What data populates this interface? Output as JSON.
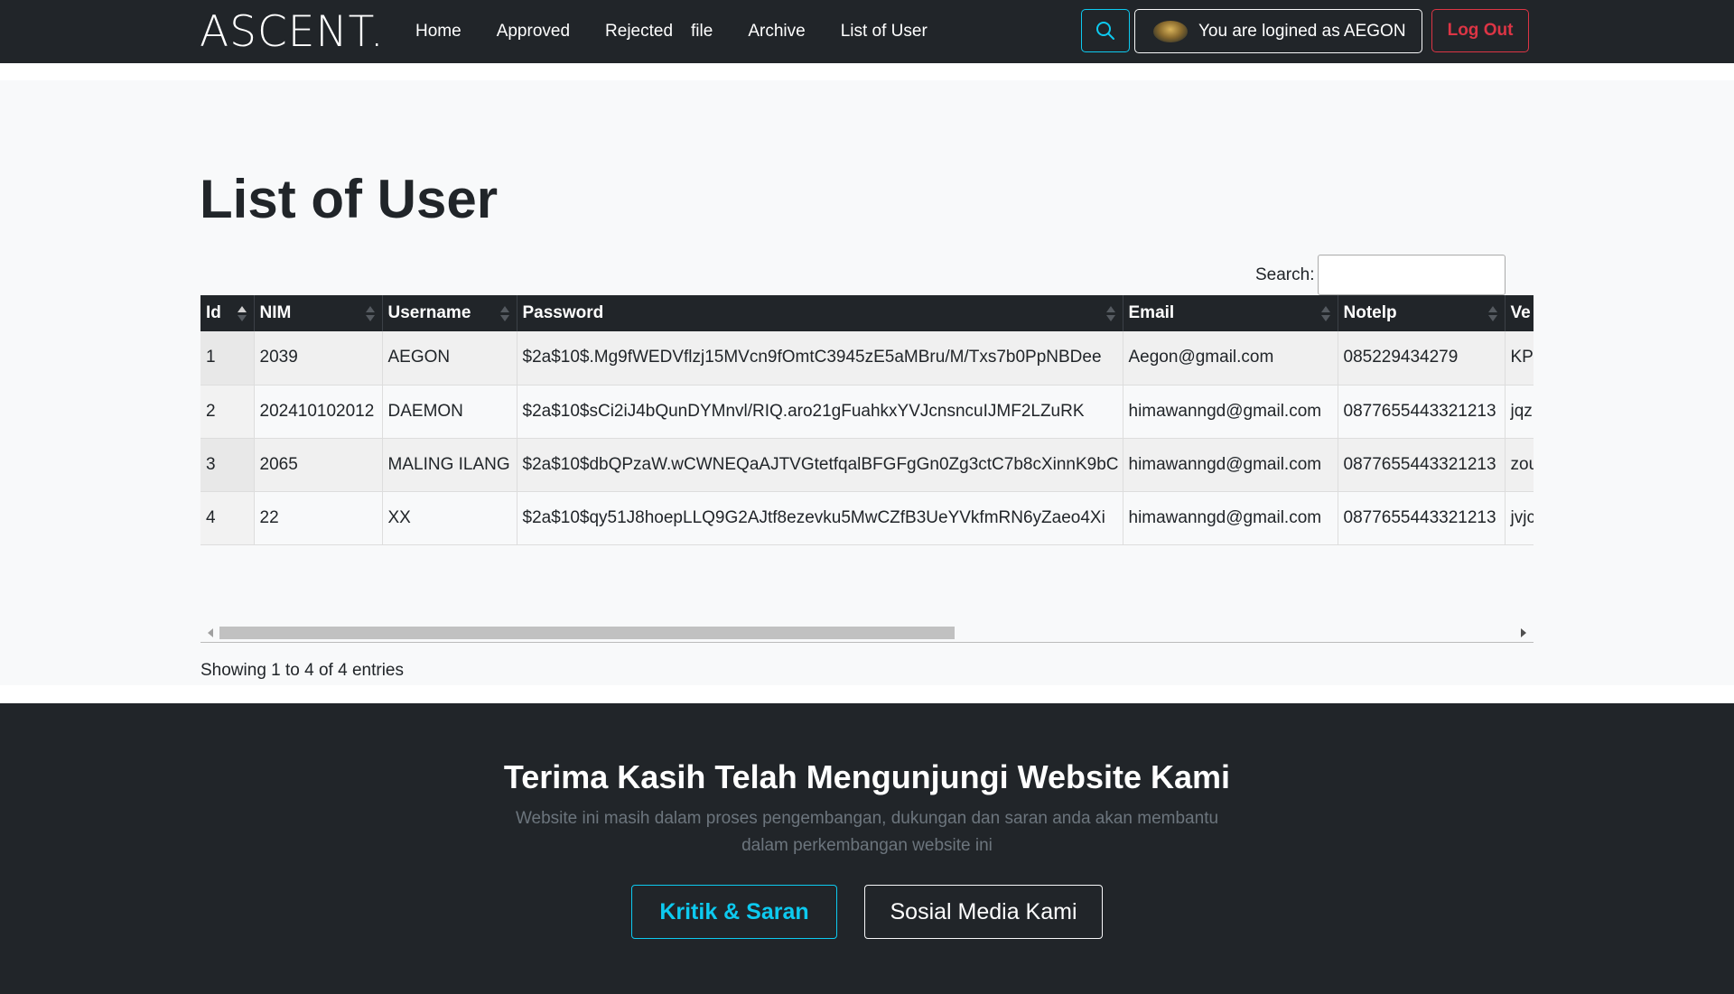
{
  "nav": {
    "brand": "ASCENT.",
    "links": [
      "Home",
      "Approved",
      "Rejected",
      "file",
      "Archive",
      "List of User"
    ],
    "user_label": "You are logined as AEGON",
    "logout_label": "Log Out"
  },
  "main": {
    "title": "List of User",
    "search_label": "Search:",
    "search_value": "",
    "columns": [
      "Id",
      "NIM",
      "Username",
      "Password",
      "Email",
      "Notelp",
      "Ve"
    ],
    "rows": [
      [
        "1",
        "2039",
        "AEGON",
        "$2a$10$.Mg9fWEDVflzj15MVcn9fOmtC3945zE5aMBru/M/Txs7b0PpNBDee",
        "Aegon@gmail.com",
        "085229434279",
        "KP"
      ],
      [
        "2",
        "202410102012",
        "DAEMON",
        "$2a$10$sCi2iJ4bQunDYMnvl/RIQ.aro21gFuahkxYVJcnsncuIJMF2LZuRK",
        "himawanngd@gmail.com",
        "0877655443321213",
        "jqz"
      ],
      [
        "3",
        "2065",
        "MALING ILANG",
        "$2a$10$dbQPzaW.wCWNEQaAJTVGtetfqalBFGFgGn0Zg3ctC7b8cXinnK9bC",
        "himawanngd@gmail.com",
        "0877655443321213",
        "zou"
      ],
      [
        "4",
        "22",
        "XX",
        "$2a$10$qy51J8hoepLLQ9G2AJtf8ezevku5MwCZfB3UeYVkfmRN6yZaeo4Xi",
        "himawanngd@gmail.com",
        "0877655443321213",
        "jvjc"
      ]
    ],
    "info": "Showing 1 to 4 of 4 entries"
  },
  "footer": {
    "title": "Terima Kasih Telah Mengunjungi Website Kami",
    "text": "Website ini masih dalam proses pengembangan, dukungan dan saran anda akan membantu dalam perkembangan website ini",
    "btn_kritik": "Kritik & Saran",
    "btn_sosial": "Sosial Media Kami"
  },
  "colors": {
    "dark": "#212529",
    "info": "#0dcaf0",
    "danger": "#dc3545",
    "light": "#f8f9fa",
    "muted": "#6c757d"
  }
}
